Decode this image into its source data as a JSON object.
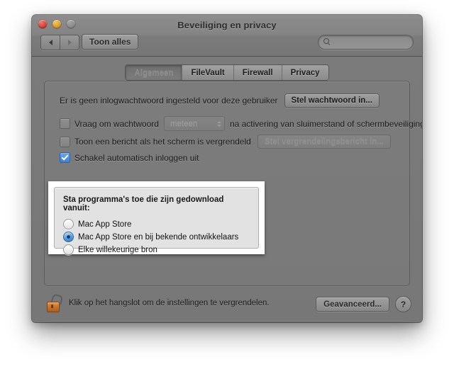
{
  "window": {
    "title": "Beveiliging en privacy",
    "traffic_lights": {
      "close": "close-button",
      "minimize": "minimize-button",
      "zoom": "zoom-button"
    }
  },
  "toolbar": {
    "back_icon": "left-arrow-icon",
    "forward_icon": "right-arrow-icon",
    "show_all_label": "Toon alles",
    "search": {
      "icon": "search-icon",
      "value": "",
      "placeholder": ""
    }
  },
  "tabs": [
    {
      "label": "Algemeen",
      "active": true
    },
    {
      "label": "FileVault",
      "active": false
    },
    {
      "label": "Firewall",
      "active": false
    },
    {
      "label": "Privacy",
      "active": false
    }
  ],
  "general": {
    "password_notice": "Er is geen inlogwachtwoord ingesteld voor deze gebruiker",
    "set_password_button": "Stel wachtwoord in...",
    "require_password_label": "Vraag om wachtwoord",
    "require_password_checked": false,
    "delay_popup_value": "meteen",
    "delay_popup_enabled": false,
    "require_password_suffix": "na activering van sluimerstand of schermbeveiliging",
    "show_message_label": "Toon een bericht als het scherm is vergrendeld",
    "show_message_checked": false,
    "set_lock_message_button": "Stel vergrendelingsbericht in...",
    "disable_auto_login_label": "Schakel automatisch inloggen uit",
    "disable_auto_login_checked": true
  },
  "download_sources": {
    "title": "Sta programma's toe die zijn gedownload vanuit:",
    "options": [
      {
        "label": "Mac App Store",
        "selected": false
      },
      {
        "label": "Mac App Store en bij bekende ontwikkelaars",
        "selected": true
      },
      {
        "label": "Elke willekeurige bron",
        "selected": false
      }
    ]
  },
  "footer": {
    "lock_icon": "unlocked-padlock-icon",
    "lock_text": "Klik op het hangslot om de instellingen te vergrendelen.",
    "advanced_button": "Geavanceerd...",
    "help_button": "?"
  },
  "colors": {
    "window_chrome": "#7b7b7b",
    "highlight_border": "#ffffff",
    "groupbox_bg": "#e2e2e2",
    "accent_blue": "#3f7fd0",
    "lock_body": "#c9772d"
  }
}
